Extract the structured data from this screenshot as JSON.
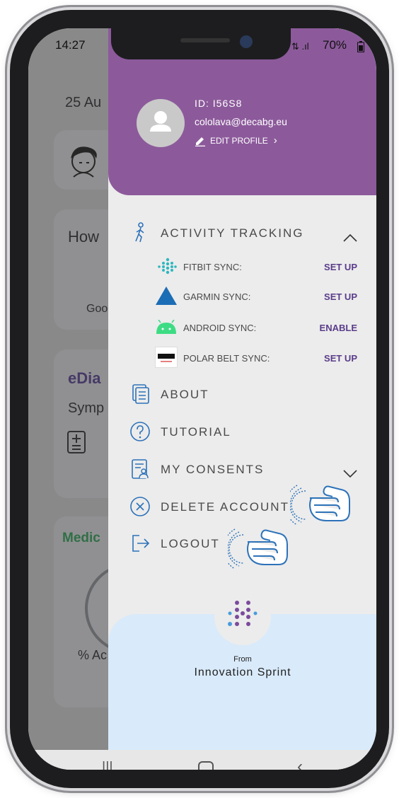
{
  "status_bar": {
    "time": "14:27",
    "signal": "⇅ .ıl",
    "battery": "70%"
  },
  "background": {
    "date": "25 Au",
    "card_how": "How",
    "card_goo": "Goo",
    "card_ediary": "eDia",
    "card_symp": "Symp",
    "card_medic": "Medic",
    "card_pct": "% Ac"
  },
  "profile": {
    "id": "ID: I56S8",
    "email": "cololava@decabg.eu",
    "edit": "EDIT PROFILE"
  },
  "menu": {
    "activity_tracking": "ACTIVITY TRACKING",
    "syncs": [
      {
        "label": "FITBIT SYNC:",
        "action": "SET UP",
        "icon": "fitbit-icon"
      },
      {
        "label": "GARMIN SYNC:",
        "action": "SET UP",
        "icon": "garmin-icon"
      },
      {
        "label": "ANDROID SYNC:",
        "action": "ENABLE",
        "icon": "android-icon"
      },
      {
        "label": "POLAR BELT SYNC:",
        "action": "SET UP",
        "icon": "polar-icon"
      }
    ],
    "about": "ABOUT",
    "tutorial": "TUTORIAL",
    "my_consents": "MY CONSENTS",
    "delete_account": "DELETE ACCOUNT",
    "logout": "LOGOUT"
  },
  "footer": {
    "from": "From",
    "company": "Innovation Sprint"
  },
  "colors": {
    "header": "#8c5a9b",
    "accent_text": "#5a3c8a",
    "footer": "#d9eafa"
  }
}
